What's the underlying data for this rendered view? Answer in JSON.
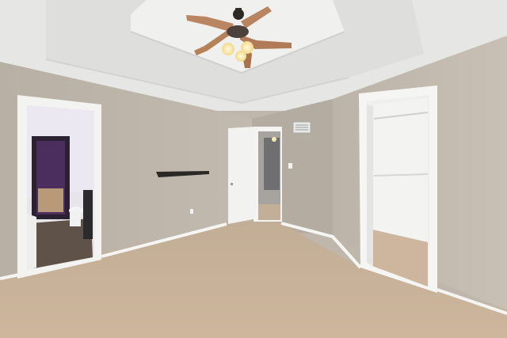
{
  "scene": {
    "kind": "empty carpeted bedroom with tray ceiling",
    "colors": {
      "ceiling": "#e9e9e7",
      "tray_inner": "#f1f1ef",
      "wall_left": "#bdb4aa",
      "wall_right": "#c7beb4",
      "wall_back": "#b6ada3",
      "carpet": "#c9b39b",
      "trim": "#f4f4f2",
      "door": "#f2f2f0",
      "fan_blade": "#b98560",
      "light_glow": "#fff6c8",
      "closet_shadow": "#5a3f6a"
    },
    "icons": [
      "ceiling-fan-icon",
      "shelf-icon",
      "mirror-icon",
      "vent-icon",
      "outlet-icon"
    ]
  }
}
